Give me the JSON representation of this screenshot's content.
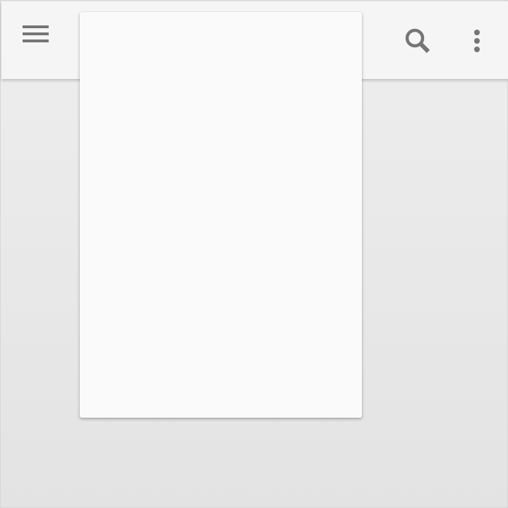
{
  "app_bar": {
    "icons": {
      "menu": "menu-icon",
      "search": "search-icon",
      "overflow": "more-vert-icon"
    },
    "icon_color": "#757575",
    "background": "#f5f5f5"
  },
  "menu_panel": {
    "items": [],
    "background": "#fafafa"
  },
  "content": {
    "background": "#e8e8e8"
  }
}
